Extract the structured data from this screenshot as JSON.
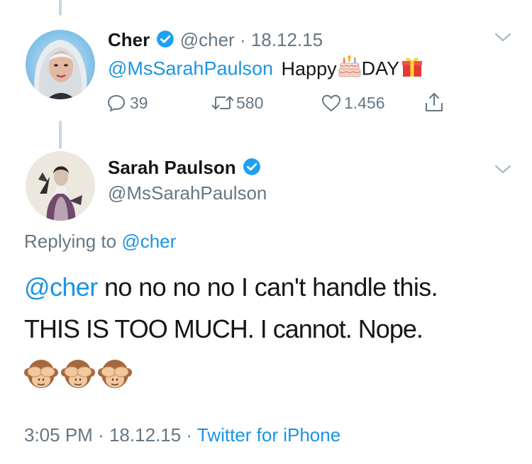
{
  "tweet1": {
    "name": "Cher",
    "handle": "@cher",
    "separator": "·",
    "date": "18.12.15",
    "mention": "@MsSarahPaulson",
    "text_before": "Happy",
    "text_after": "DAY",
    "emoji_1": "birthday-cake-icon",
    "emoji_2": "wrapped-gift-icon",
    "actions": {
      "reply_count": "39",
      "retweet_count": "580",
      "like_count": "1.456"
    }
  },
  "tweet2": {
    "name": "Sarah Paulson",
    "handle": "@MsSarahPaulson",
    "replying_prefix": "Replying to",
    "replying_to": "@cher",
    "mention": "@cher",
    "text_line1": "no no no no I can't handle this.",
    "text_line2": "THIS IS TOO MUCH. I cannot. Nope.",
    "emojis": [
      "see-no-evil-monkey-icon",
      "see-no-evil-monkey-icon",
      "see-no-evil-monkey-icon"
    ],
    "time": "3:05 PM",
    "sep1": "·",
    "date": "18.12.15",
    "sep2": "·",
    "source": "Twitter for iPhone"
  },
  "colors": {
    "link_blue": "#1b95e0",
    "text_gray": "#657786",
    "verified_blue": "#1da1f2",
    "thread_line": "#ccd6dd"
  }
}
